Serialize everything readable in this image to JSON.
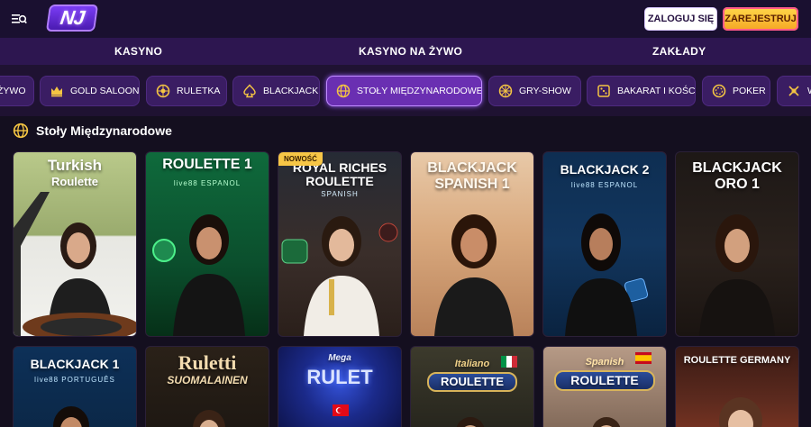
{
  "header": {
    "logo_text": "NJ",
    "login_label": "ZALOGUJ SIĘ",
    "register_label": "ZAREJESTRUJ"
  },
  "main_nav": [
    "KASYNO",
    "KASYNO NA ŻYWO",
    "ZAKŁADY"
  ],
  "categories": [
    {
      "label": "ŻYWO",
      "icon": "live-icon"
    },
    {
      "label": "GOLD SALOON",
      "icon": "crown-icon"
    },
    {
      "label": "RULETKA",
      "icon": "roulette-icon"
    },
    {
      "label": "BLACKJACK",
      "icon": "spade-icon"
    },
    {
      "label": "STOŁY MIĘDZYNARODOWE",
      "icon": "globe-icon",
      "active": true
    },
    {
      "label": "GRY-SHOW",
      "icon": "wheel-icon"
    },
    {
      "label": "BAKARAT I KOŚCI",
      "icon": "dice-icon"
    },
    {
      "label": "POKER",
      "icon": "chip-icon"
    },
    {
      "label": "W",
      "icon": "cards-icon"
    }
  ],
  "section": {
    "title": "Stoły Międzynarodowe",
    "icon": "globe-icon"
  },
  "games_row1": [
    {
      "title_line1": "Turkish",
      "title_line2": "Roulette",
      "sub": ""
    },
    {
      "title_line1": "ROULETTE 1",
      "title_line2": "",
      "sub": "live88   ESPANOL"
    },
    {
      "title_line1": "ROYAL RICHES",
      "title_line2": "ROULETTE",
      "sub": "SPANISH",
      "badge": "NOWOŚĆ"
    },
    {
      "title_line1": "BLACKJACK",
      "title_line2": "SPANISH 1",
      "sub": ""
    },
    {
      "title_line1": "BLACKJACK 2",
      "title_line2": "",
      "sub": "live88   ESPANOL"
    },
    {
      "title_line1": "BLACKJACK",
      "title_line2": "ORO 1",
      "sub": ""
    }
  ],
  "games_row2": [
    {
      "title_line1": "BLACKJACK 1",
      "title_line2": "",
      "sub": "live88   PORTUGUÊS"
    },
    {
      "title_line1": "Ruletti",
      "title_line2": "SUOMALAINEN",
      "sub": ""
    },
    {
      "title_line1": "Mega",
      "title_line2": "RULET",
      "sub": ""
    },
    {
      "title_line1": "Italiano",
      "title_line2": "ROULETTE",
      "sub": ""
    },
    {
      "title_line1": "Spanish",
      "title_line2": "ROULETTE",
      "sub": ""
    },
    {
      "title_line1": "ROULETTE GERMANY",
      "title_line2": "",
      "sub": ""
    }
  ]
}
